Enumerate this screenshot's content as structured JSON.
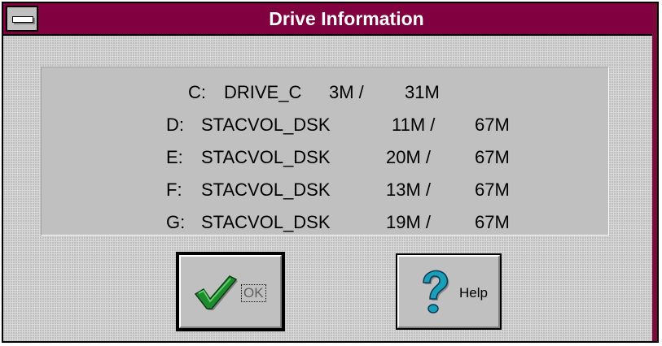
{
  "window": {
    "title": "Drive Information"
  },
  "drives": [
    {
      "letter": "C:",
      "label": "DRIVE_C",
      "free": "3M /",
      "total": "31M"
    },
    {
      "letter": "D:",
      "label": "STACVOL_DSK",
      "free": "11M /",
      "total": "67M"
    },
    {
      "letter": "E:",
      "label": "STACVOL_DSK",
      "free": "20M /",
      "total": "67M"
    },
    {
      "letter": "F:",
      "label": "STACVOL_DSK",
      "free": "13M /",
      "total": "67M"
    },
    {
      "letter": "G:",
      "label": "STACVOL_DSK",
      "free": "19M /",
      "total": "67M"
    }
  ],
  "buttons": {
    "ok_label": "OK",
    "help_label": "Help"
  },
  "icons": {
    "system_menu": "system-menu-icon",
    "ok": "checkmark-icon",
    "help": "question-mark-icon"
  },
  "colors": {
    "titlebar": "#800040",
    "panel": "#c0c0c0",
    "checkmark": "#1f8a2e",
    "question": "#19a0b8"
  }
}
